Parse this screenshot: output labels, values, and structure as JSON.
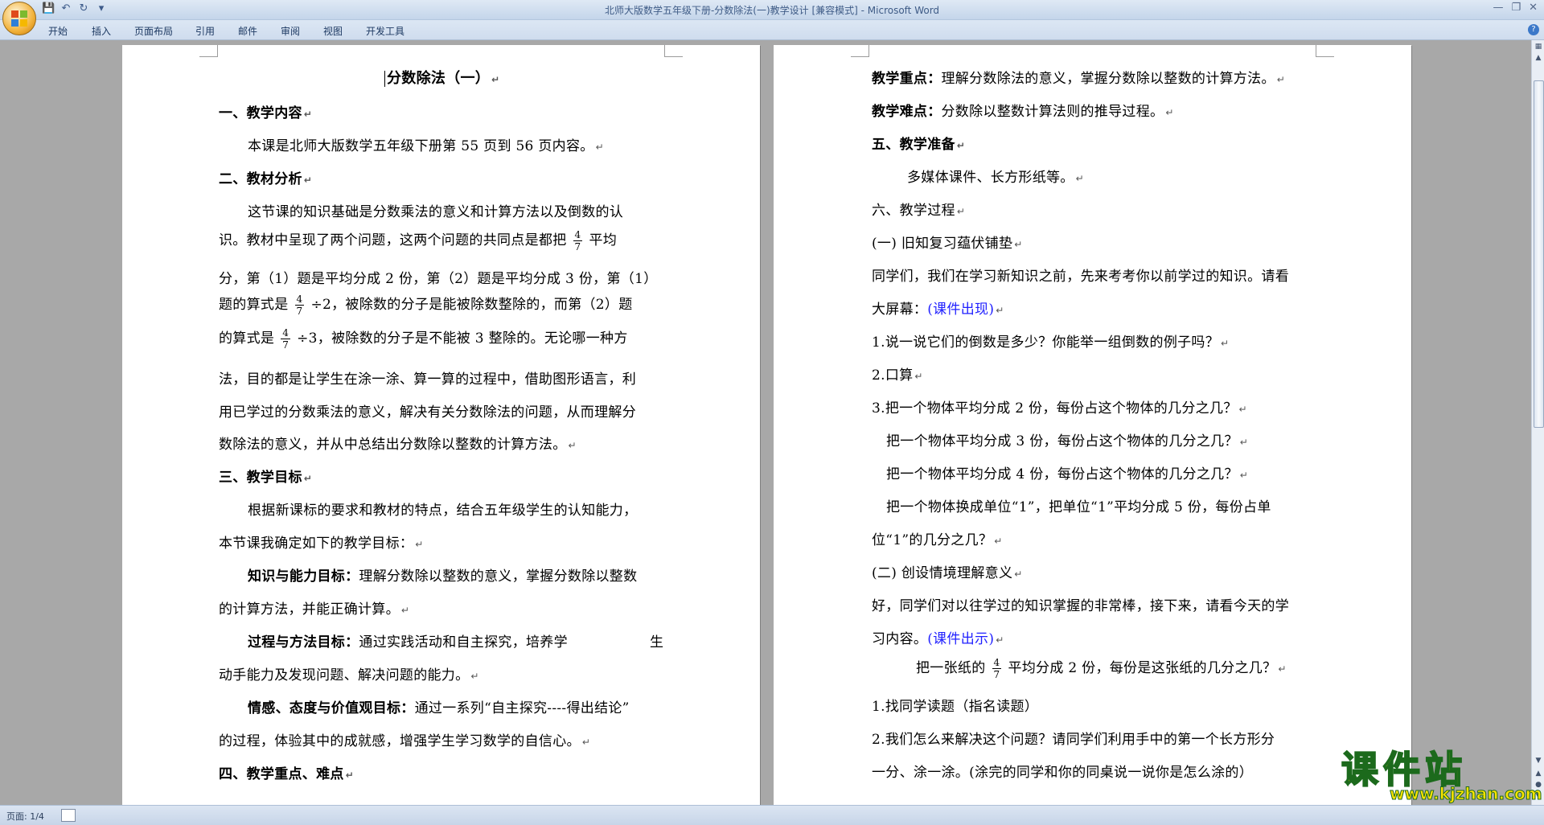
{
  "window": {
    "doc_title": "北师大版数学五年级下册-分数除法(一)教学设计 [兼容模式]",
    "separator": " - ",
    "app_name": "Microsoft Word"
  },
  "ribbon_tabs": [
    "开始",
    "插入",
    "页面布局",
    "引用",
    "邮件",
    "审阅",
    "视图",
    "开发工具"
  ],
  "para_mark": "↵",
  "fraction": {
    "num": "4",
    "den": "7"
  },
  "page1": {
    "title": "分数除法（一）",
    "h1": "一、教学内容",
    "p1": "本课是北师大版数学五年级下册第 55 页到 56 页内容。",
    "h2": "二、教材分析",
    "p2_l1": "这节课的知识基础是分数乘法的意义和计算方法以及倒数的认",
    "p2_l2a": "识。教材中呈现了两个问题，这两个问题的共同点是都把",
    "p2_l2b": "平均",
    "p2_l3": "分，第（1）题是平均分成 2 份，第（2）题是平均分成 3 份，第（1）",
    "p2_l4a": "题的算式是",
    "p2_l4b": "÷2，被除数的分子是能被除数整除的，而第（2）题",
    "p2_l5a": "的算式是",
    "p2_l5b": "÷3，被除数的分子是不能被 3 整除的。无论哪一种方",
    "p2_l6": "法，目的都是让学生在涂一涂、算一算的过程中，借助图形语言，利",
    "p2_l7": "用已学过的分数乘法的意义，解决有关分数除法的问题，从而理解分",
    "p2_l8": "数除法的意义，并从中总结出分数除以整数的计算方法。",
    "h3": "三、教学目标",
    "p3_l1": "根据新课标的要求和教材的特点，结合五年级学生的认知能力，",
    "p3_l2": "本节课我确定如下的教学目标：",
    "g1_label": "知识与能力目标：",
    "g1_text": "理解分数除以整数的意义，掌握分数除以整数",
    "g1_l2": "的计算方法，并能正确计算。",
    "g2_label": "过程与方法目标：",
    "g2_text": "通过实践活动和自主探究，培养学",
    "g2_tail": "生",
    "g2_l2": "动手能力及发现问题、解决问题的能力。",
    "g3_label": "情感、态度与价值观目标：",
    "g3_text": "通过一系列“自主探究----得出结论”",
    "g3_l2": "的过程，体验其中的成就感，增强学生学习数学的自信心。",
    "h4": "四、教学重点、难点"
  },
  "page2": {
    "key_label": "教学重点：",
    "key_text": "理解分数除法的意义，掌握分数除以整数的计算方法。",
    "diff_label": "教学难点：",
    "diff_text": "分数除以整数计算法则的推导过程。",
    "h5": "五、教学准备",
    "prep": "多媒体课件、长方形纸等。",
    "h6": "六、教学过程",
    "s1": "(一) 旧知复习蕴伏铺垫",
    "s1_p1": "同学们，我们在学习新知识之前，先来考考你以前学过的知识。请看",
    "s1_p2a": "大屏幕：",
    "s1_p2b": "(课件出现)",
    "q1": "1.说一说它们的倒数是多少？你能举一组倒数的例子吗？",
    "q2": "2.口算",
    "q3": "3.把一个物体平均分成 2 份，每份占这个物体的几分之几？",
    "q3b": "把一个物体平均分成 3 份，每份占这个物体的几分之几？",
    "q3c": "把一个物体平均分成 4 份，每份占这个物体的几分之几？",
    "q3d": "把一个物体换成单位“1”，把单位“1”平均分成 5 份，每份占单",
    "q3d2": "位“1”的几分之几？",
    "s2": "(二) 创设情境理解意义",
    "s2_p1": "好，同学们对以往学过的知识掌握的非常棒，接下来，请看今天的学",
    "s2_p2a": "习内容。",
    "s2_p2b": "(课件出示)",
    "s2_p3a": "把一张纸的",
    "s2_p3b": "平均分成 2 份，每份是这张纸的几分之几？",
    "s2_q1": "1.找同学读题（指名读题）",
    "s2_q2": "2.我们怎么来解决这个问题？请同学们利用手中的第一个长方形分",
    "s2_q3": "一分、涂一涂。(涂完的同学和你的同桌说一说你是怎么涂的）"
  },
  "status": {
    "page": "页面: 1/4"
  },
  "watermark": {
    "brand": "课件站",
    "url": "www.kjzhan.com"
  },
  "colors": {
    "link_blue": "#1f1fff",
    "watermark_yellow": "#ffe400",
    "watermark_outline": "#1c6a1c"
  }
}
